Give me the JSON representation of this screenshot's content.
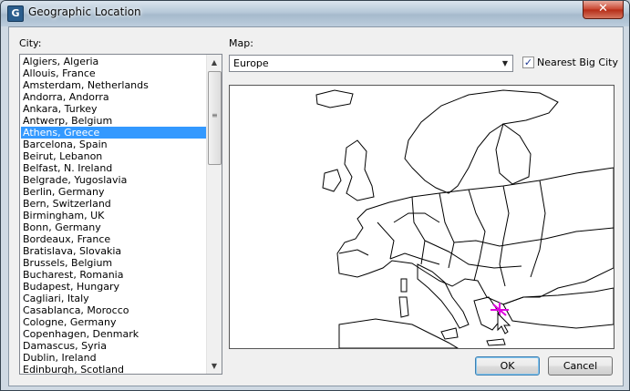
{
  "window": {
    "title": "Geographic Location",
    "close_glyph": "✕",
    "app_icon": "G"
  },
  "city": {
    "label": "City:",
    "items": [
      "Algiers, Algeria",
      "Allouis, France",
      "Amsterdam, Netherlands",
      "Andorra, Andorra",
      "Ankara, Turkey",
      "Antwerp, Belgium",
      "Athens, Greece",
      "Barcelona, Spain",
      "Beirut, Lebanon",
      "Belfast, N. Ireland",
      "Belgrade, Yugoslavia",
      "Berlin, Germany",
      "Bern, Switzerland",
      "Birmingham, UK",
      "Bonn, Germany",
      "Bordeaux, France",
      "Bratislava, Slovakia",
      "Brussels, Belgium",
      "Bucharest, Romania",
      "Budapest, Hungary",
      "Cagliari, Italy",
      "Casablanca, Morocco",
      "Cologne, Germany",
      "Copenhagen, Denmark",
      "Damascus, Syria",
      "Dublin, Ireland",
      "Edinburgh, Scotland"
    ],
    "selected_index": 6
  },
  "map": {
    "label": "Map:",
    "selected": "Europe",
    "marker_icon": "crosshair-marker-icon"
  },
  "nearest": {
    "label": "Nearest Big City",
    "checked": true
  },
  "buttons": {
    "ok": "OK",
    "cancel": "Cancel"
  },
  "colors": {
    "selection": "#3399ff",
    "marker": "#e000e0"
  }
}
